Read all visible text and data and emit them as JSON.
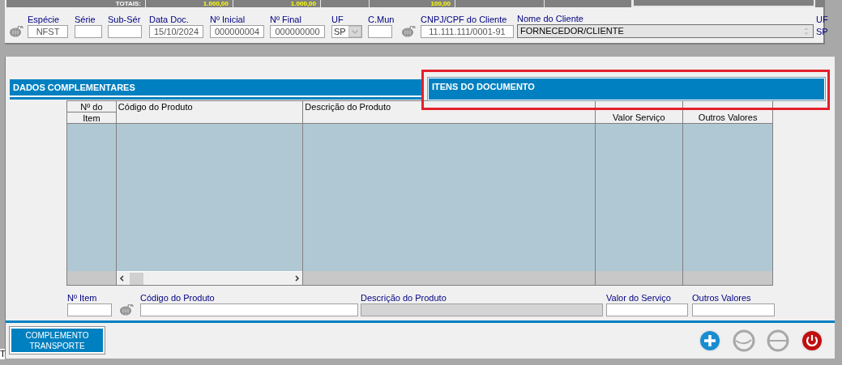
{
  "totals_bar": {
    "label": "TOTAIS:",
    "values": [
      "1.000,00",
      "1.000,00",
      "100,00"
    ]
  },
  "header_fields": [
    {
      "kind": "lookup"
    },
    {
      "kind": "text",
      "label": "Espécie",
      "value": "NFST"
    },
    {
      "kind": "text",
      "label": "Série"
    },
    {
      "kind": "text",
      "label": "Sub-Sér"
    },
    {
      "kind": "text",
      "label": "Data Doc.",
      "value": "15/10/2024"
    },
    {
      "kind": "text",
      "label": "Nº Inicial",
      "value": "000000004"
    },
    {
      "kind": "text",
      "label": "Nº Final",
      "value": "000000000"
    },
    {
      "kind": "select",
      "label": "UF",
      "value": "SP"
    },
    {
      "kind": "text",
      "label": "C.Mun"
    },
    {
      "kind": "lookup"
    },
    {
      "kind": "text",
      "label": "CNPJ/CPF do Cliente",
      "value": "11.111.111/0001-91"
    },
    {
      "kind": "memo",
      "label": "Nome do Cliente",
      "value": "FORNECEDOR/CLIENTE"
    },
    {
      "kind": "static",
      "label": "UF",
      "value": "SP"
    }
  ],
  "tabs": [
    {
      "label": "DADOS COMPLEMENTARES",
      "selected": false,
      "highlighted": false
    },
    {
      "label": "ITENS DO DOCUMENTO",
      "selected": true,
      "highlighted": true
    }
  ],
  "table": {
    "columns": [
      {
        "lines": [
          "Nº do",
          "Item"
        ]
      },
      {
        "lines": [
          "Código do Produto"
        ]
      },
      {
        "lines": [
          "Descrição do Produto"
        ]
      },
      {
        "lines": [
          "Valor Serviço"
        ]
      },
      {
        "lines": [
          "Outros Valores"
        ]
      }
    ]
  },
  "item_fields": [
    {
      "kind": "text",
      "label": "Nº Item"
    },
    {
      "kind": "lookup"
    },
    {
      "kind": "text",
      "label": "Código do Produto"
    },
    {
      "kind": "readonly",
      "label": "Descrição do Produto"
    },
    {
      "kind": "text",
      "label": "Valor do Serviço"
    },
    {
      "kind": "text",
      "label": "Outros Valores"
    }
  ],
  "button": {
    "label": "COMPLEMENTO TRANSPORTE"
  },
  "actions": [
    {
      "kind": "add",
      "disabled": false
    },
    {
      "kind": "circle-slash",
      "disabled": true
    },
    {
      "kind": "circle-cap",
      "disabled": true
    },
    {
      "kind": "power",
      "disabled": false
    }
  ],
  "edge_text": "T"
}
